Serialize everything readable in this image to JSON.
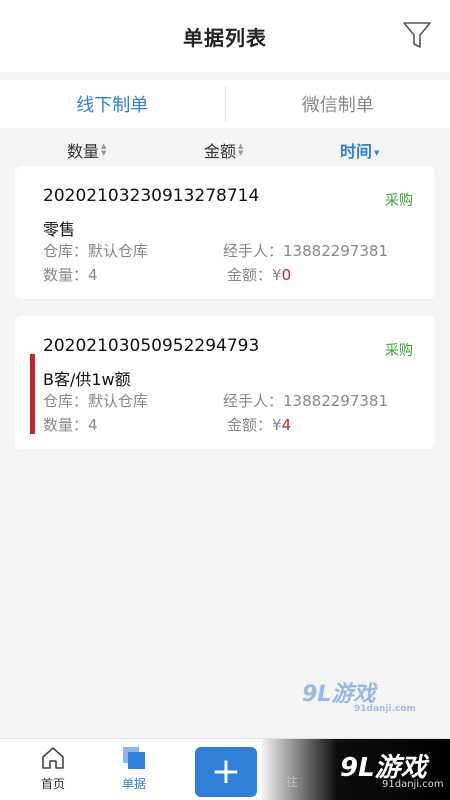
{
  "header": {
    "title": "单据列表",
    "filter_icon": "filter-icon"
  },
  "tabs": [
    {
      "label": "线下制单",
      "active": true
    },
    {
      "label": "微信制单",
      "active": false
    }
  ],
  "sort": [
    {
      "label": "数量",
      "active": false
    },
    {
      "label": "金额",
      "active": false
    },
    {
      "label": "时间",
      "active": true
    }
  ],
  "records": [
    {
      "code": "20202103230913278714",
      "tag": "采购",
      "name": "零售",
      "warehouse_label": "仓库：",
      "warehouse": "默认仓库",
      "handler_label": "经手人：",
      "handler": "13882297381",
      "qty_label": "数量：",
      "qty": "4",
      "amount_label": "金额：",
      "amount_currency": "¥",
      "amount": "0"
    },
    {
      "code": "20202103050952294793",
      "tag": "采购",
      "name": "B客/供1w额",
      "warehouse_label": "仓库：",
      "warehouse": "默认仓库",
      "handler_label": "经手人：",
      "handler": "13882297381",
      "qty_label": "数量：",
      "qty": "4",
      "amount_label": "金额：",
      "amount_currency": "¥",
      "amount": "4"
    }
  ],
  "watermark": {
    "big": "9L游戏",
    "small": "91danji.com"
  },
  "bottomnav": {
    "home": "首页",
    "documents": "单据",
    "add": "+",
    "partial": "往",
    "overlay_big": "9L游戏",
    "overlay_small": "91danji.com"
  },
  "colors": {
    "accent": "#2f80d6",
    "tag": "#3aa53a",
    "amount": "#c0272d"
  }
}
